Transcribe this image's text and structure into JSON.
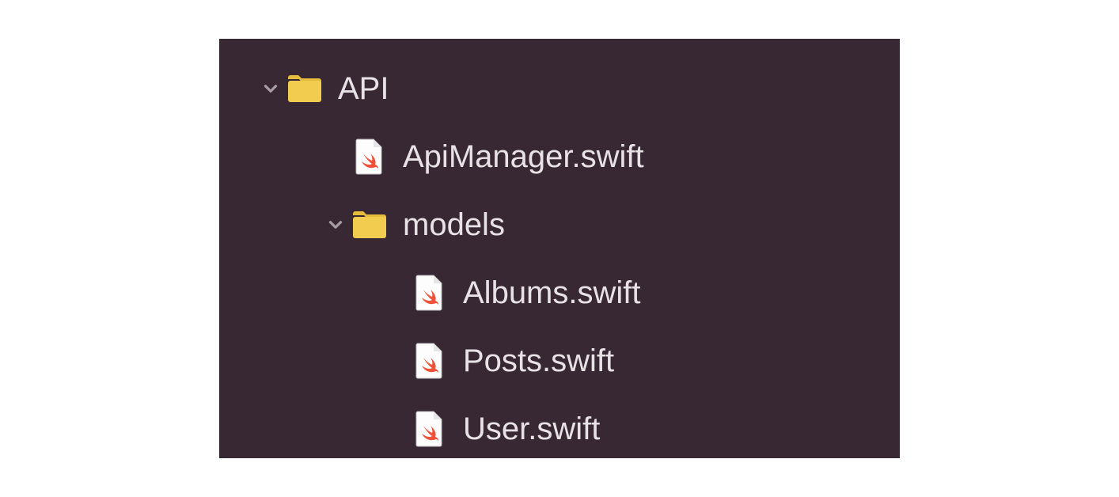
{
  "colors": {
    "panel_bg": "#382833",
    "text": "#e8e2e6",
    "folder_light": "#f2cc4e",
    "folder_dark": "#e5bc3c",
    "file_bg": "#fdfdfd",
    "swift_orange": "#f05138",
    "chevron": "#a89ca5"
  },
  "tree": {
    "api": {
      "name": "API",
      "expanded": true,
      "children": {
        "apimanager": {
          "name": "ApiManager.swift",
          "type": "swift"
        },
        "models": {
          "name": "models",
          "expanded": true,
          "children": {
            "albums": {
              "name": "Albums.swift",
              "type": "swift"
            },
            "posts": {
              "name": "Posts.swift",
              "type": "swift"
            },
            "user": {
              "name": "User.swift",
              "type": "swift"
            }
          }
        }
      }
    }
  }
}
